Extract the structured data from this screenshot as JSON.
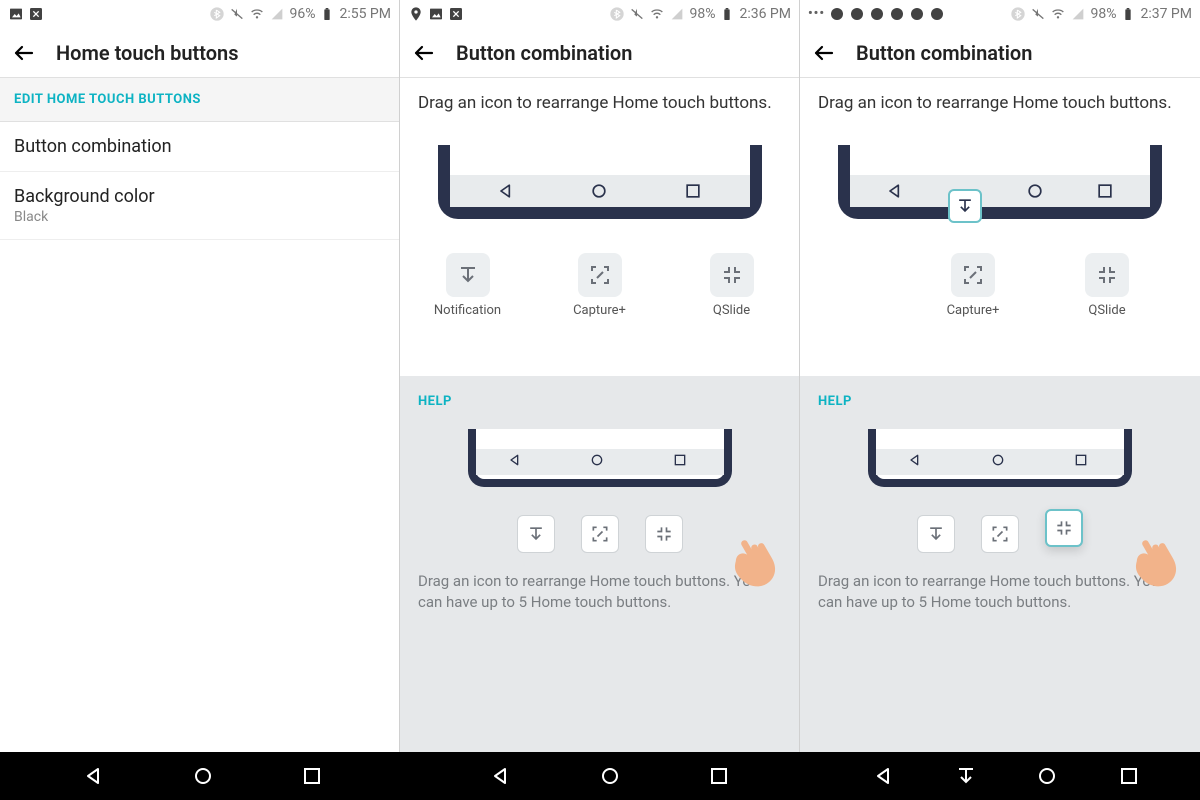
{
  "screens": {
    "s1": {
      "status": {
        "battery": "96%",
        "time": "2:55 PM"
      },
      "title": "Home touch buttons",
      "section_header": "EDIT HOME TOUCH BUTTONS",
      "rows": [
        {
          "title": "Button combination"
        },
        {
          "title": "Background color",
          "sub": "Black"
        }
      ]
    },
    "s2": {
      "status": {
        "battery": "98%",
        "time": "2:36 PM"
      },
      "title": "Button combination",
      "intro": "Drag an icon to rearrange Home touch buttons.",
      "nav_slots": [
        "back",
        "home",
        "recent"
      ],
      "pool": [
        {
          "id": "notification",
          "label": "Notification"
        },
        {
          "id": "capture",
          "label": "Capture+"
        },
        {
          "id": "qslide",
          "label": "QSlide"
        }
      ],
      "help": {
        "title": "HELP",
        "text": "Drag an icon to rearrange Home touch buttons. You can have up to 5 Home touch buttons."
      }
    },
    "s3": {
      "status": {
        "battery": "98%",
        "time": "2:37 PM"
      },
      "title": "Button combination",
      "intro": "Drag an icon to rearrange Home touch buttons.",
      "nav_slots": [
        "back",
        "notification-drop",
        "home",
        "recent"
      ],
      "pool": [
        {
          "id": "capture",
          "label": "Capture+"
        },
        {
          "id": "qslide",
          "label": "QSlide"
        }
      ],
      "help": {
        "title": "HELP",
        "text": "Drag an icon to rearrange Home touch buttons. You can have up to 5 Home touch buttons."
      }
    }
  },
  "sysnav": {
    "s1": [
      "back",
      "home",
      "recent"
    ],
    "s2": [
      "back",
      "home",
      "recent"
    ],
    "s3": [
      "back",
      "notification",
      "home",
      "recent"
    ]
  }
}
